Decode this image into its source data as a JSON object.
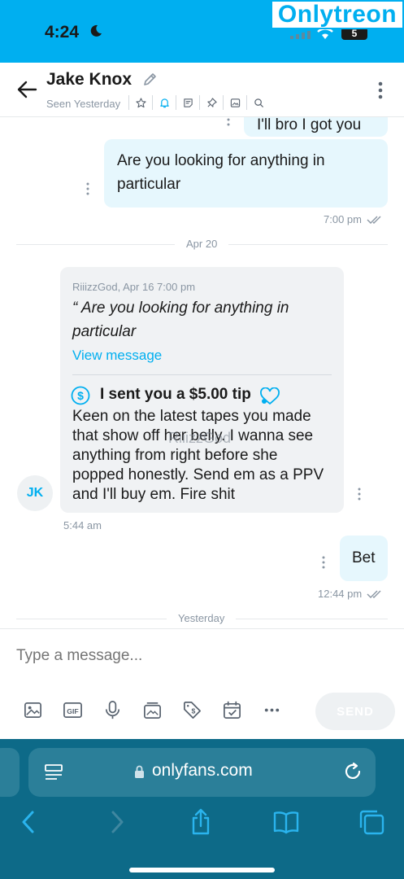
{
  "status": {
    "time": "4:24",
    "battery": "5"
  },
  "watermark": {
    "text": "Onlytreon"
  },
  "header": {
    "name": "Jake Knox",
    "seen": "Seen Yesterday",
    "icons": [
      "star-icon",
      "bell-icon",
      "note-icon",
      "pin-icon",
      "image-icon",
      "search-icon"
    ]
  },
  "messages": {
    "partial_top": "I'll bro I got you",
    "outgoing_1": {
      "text": "Are you looking for anything in particular",
      "time": "7:00 pm"
    },
    "divider_1": "Apr 20",
    "incoming": {
      "quote_meta": "RiiizzGod, Apr 16 7:00 pm",
      "quote_text": "“ Are you looking for anything in particular",
      "view_message": "View message",
      "tip_text": "I sent you a $5.00 tip",
      "body": "Keen on the latest tapes you made that show off her belly. I wanna see anything from right before she popped honestly. Send em as a PPV and I'll buy em. Fire shit",
      "watermark": "RiiizzGod",
      "avatar": "JK",
      "time": "5:44 am"
    },
    "outgoing_2": {
      "text": "Bet",
      "time": "12:44 pm"
    },
    "divider_2": "Yesterday"
  },
  "composer": {
    "placeholder": "Type a message...",
    "tools": [
      "image-icon",
      "gif-icon",
      "microphone-icon",
      "media-vault-icon",
      "price-tag-icon",
      "calendar-icon",
      "more-icon"
    ],
    "send_label": "SEND"
  },
  "browser": {
    "url": "onlyfans.com"
  },
  "colors": {
    "accent": "#00aff0",
    "bubble_out": "#e6f7fd",
    "bubble_in": "#f0f2f4",
    "browser_bar": "#0d6a88"
  }
}
